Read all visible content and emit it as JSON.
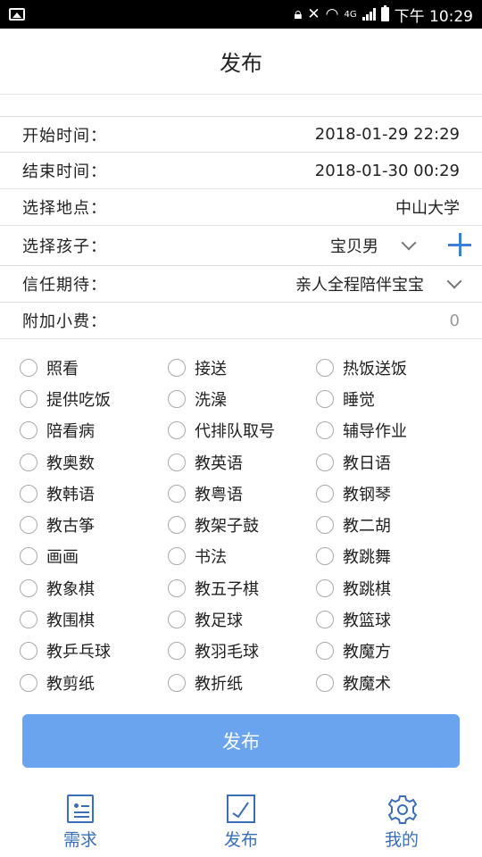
{
  "status_bar": {
    "network": "4G",
    "time": "下午 10:29"
  },
  "header": {
    "title": "发布"
  },
  "form": {
    "start_time": {
      "label": "开始时间：",
      "value": "2018-01-29 22:29"
    },
    "end_time": {
      "label": "结束时间：",
      "value": "2018-01-30 00:29"
    },
    "location": {
      "label": "选择地点：",
      "value": "中山大学"
    },
    "child": {
      "label": "选择孩子：",
      "value": "宝贝男"
    },
    "trust": {
      "label": "信任期待：",
      "value": "亲人全程陪伴宝宝"
    },
    "tip": {
      "label": "附加小费：",
      "value": "0"
    }
  },
  "options": [
    "照看",
    "接送",
    "热饭送饭",
    "提供吃饭",
    "洗澡",
    "睡觉",
    "陪看病",
    "代排队取号",
    "辅导作业",
    "教奥数",
    "教英语",
    "教日语",
    "教韩语",
    "教粤语",
    "教钢琴",
    "教古筝",
    "教架子鼓",
    "教二胡",
    "画画",
    "书法",
    "教跳舞",
    "教象棋",
    "教五子棋",
    "教跳棋",
    "教围棋",
    "教足球",
    "教篮球",
    "教乒乓球",
    "教羽毛球",
    "教魔方",
    "教剪纸",
    "教折纸",
    "教魔术"
  ],
  "publish_button": "发布",
  "bottom_nav": [
    {
      "label": "需求",
      "icon": "demand-icon"
    },
    {
      "label": "发布",
      "icon": "publish-icon"
    },
    {
      "label": "我的",
      "icon": "gear-icon"
    }
  ],
  "colors": {
    "accent": "#3a6fb5",
    "button": "#6aa4ee",
    "plus": "#3d7fd4"
  }
}
